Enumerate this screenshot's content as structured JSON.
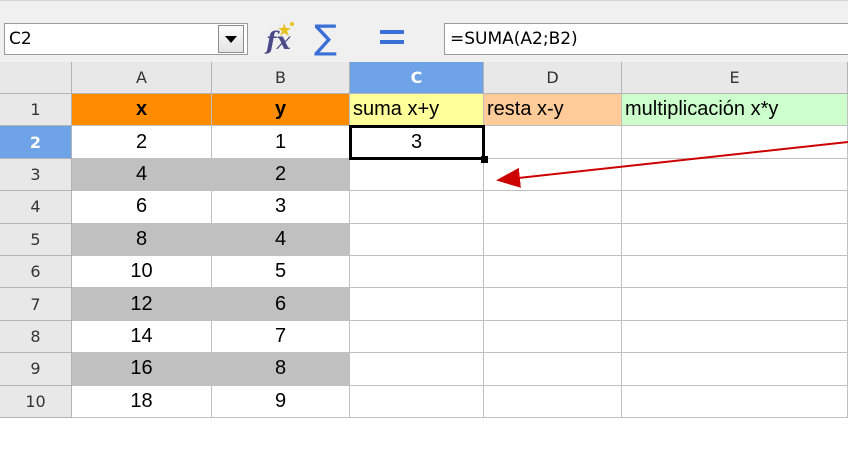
{
  "name_box": {
    "value": "C2"
  },
  "formula": {
    "value": "=SUMA(A2;B2)"
  },
  "icons": {
    "dropdown": "chevron-down-icon",
    "function_wizard": "fx-icon",
    "sum": "sigma-icon",
    "formula": "equals-icon"
  },
  "columns": [
    "A",
    "B",
    "C",
    "D",
    "E"
  ],
  "selected_column": "C",
  "selected_row": "2",
  "rows": [
    {
      "num": "1",
      "cells": [
        "x",
        "y",
        "suma x+y",
        "resta x-y",
        "multiplicación x*y"
      ]
    },
    {
      "num": "2",
      "cells": [
        "2",
        "1",
        "3",
        "",
        ""
      ]
    },
    {
      "num": "3",
      "cells": [
        "4",
        "2",
        "",
        "",
        ""
      ]
    },
    {
      "num": "4",
      "cells": [
        "6",
        "3",
        "",
        "",
        ""
      ]
    },
    {
      "num": "5",
      "cells": [
        "8",
        "4",
        "",
        "",
        ""
      ]
    },
    {
      "num": "6",
      "cells": [
        "10",
        "5",
        "",
        "",
        ""
      ]
    },
    {
      "num": "7",
      "cells": [
        "12",
        "6",
        "",
        "",
        ""
      ]
    },
    {
      "num": "8",
      "cells": [
        "14",
        "7",
        "",
        "",
        ""
      ]
    },
    {
      "num": "9",
      "cells": [
        "16",
        "8",
        "",
        "",
        ""
      ]
    },
    {
      "num": "10",
      "cells": [
        "18",
        "9",
        "",
        "",
        ""
      ]
    }
  ],
  "colors": {
    "header_xy": "#ff8c00",
    "header_sum": "#ffff99",
    "header_diff": "#ffcc99",
    "header_mult": "#ccffcc",
    "stripe": "#c0c0c0",
    "annotation_arrow": "#cc0000"
  }
}
